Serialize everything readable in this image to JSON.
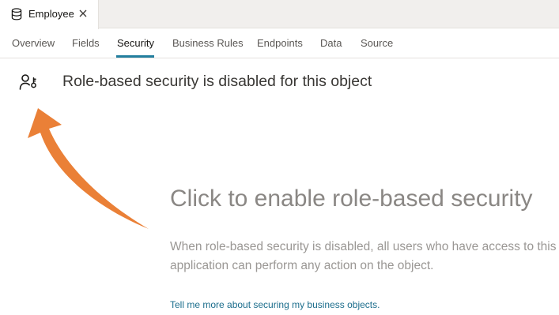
{
  "tab": {
    "label": "Employee",
    "icon": "database-icon",
    "close_icon": "close-icon"
  },
  "subnav": {
    "items": [
      {
        "label": "Overview"
      },
      {
        "label": "Fields"
      },
      {
        "label": "Security"
      },
      {
        "label": "Business Rules"
      },
      {
        "label": "Endpoints"
      },
      {
        "label": "Data"
      },
      {
        "label": "Source"
      }
    ],
    "active": "Security"
  },
  "security": {
    "icon": "role-security-icon",
    "heading": "Role-based security is disabled for this object"
  },
  "cta": {
    "title": "Click to enable role-based security",
    "description": "When role-based security is disabled, all users who have access to this application can perform any action on the object.",
    "link": "Tell me more about securing my business objects."
  },
  "colors": {
    "accent": "#227e9e",
    "arrow": "#ea8037",
    "link": "#1b6d8c"
  }
}
